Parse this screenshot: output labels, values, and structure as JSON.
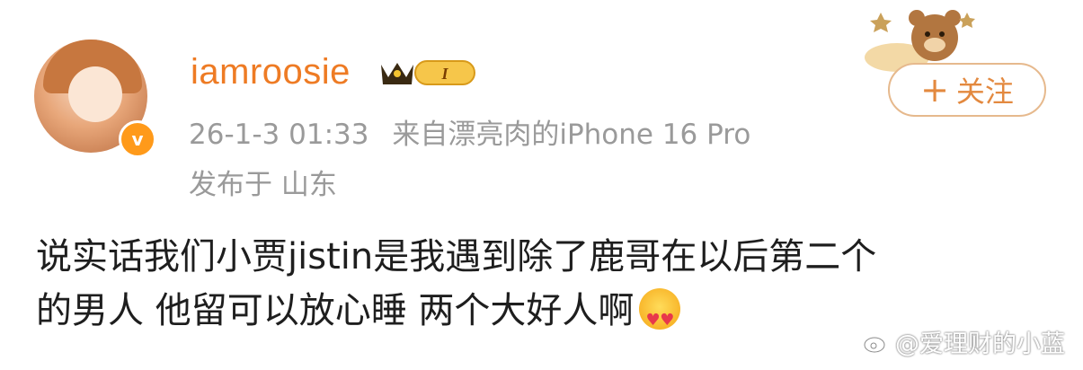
{
  "post": {
    "username": "iamroosie",
    "timestamp": "26-1-3 01:33",
    "source": "来自漂亮肉的iPhone 16 Pro",
    "location": "发布于 山东",
    "follow_label": "关注",
    "vip_level": "I",
    "text_line1": "说实话我们小贾jistin是我遇到除了鹿哥在以后第二个",
    "text_line2": "的男人 他留可以放心睡 两个大好人啊"
  },
  "watermark": {
    "text": "@爱理财的小蓝"
  },
  "colors": {
    "username": "#ee7b24",
    "meta": "#9a9a9a",
    "follow_border": "#e6b98d",
    "follow_text": "#e3893f",
    "verified": "#ff9a1a"
  },
  "icons": {
    "verified": "verified-badge-icon",
    "vip": "crown-vip-icon",
    "emoji": "heart-eyes-emoji-icon",
    "watermark": "weibo-logo-icon"
  }
}
